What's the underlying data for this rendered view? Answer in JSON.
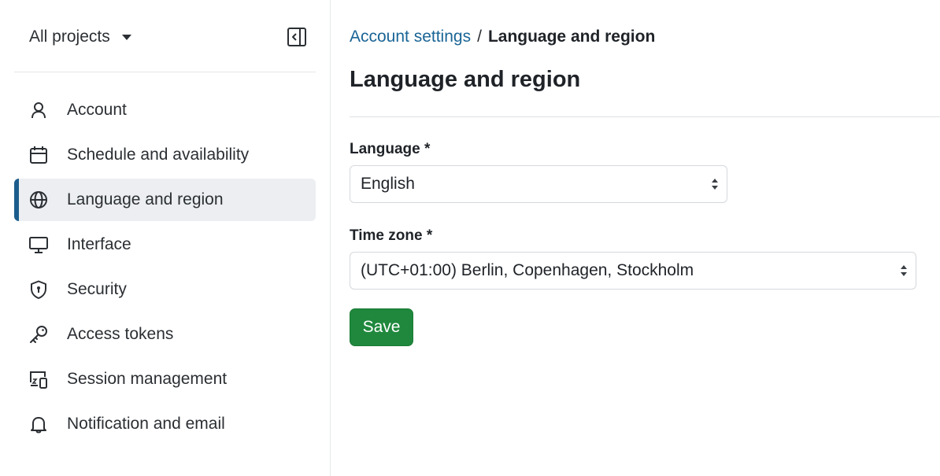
{
  "sidebar": {
    "project_selector": "All projects",
    "items": [
      {
        "label": "Account",
        "icon": "person-icon",
        "active": false
      },
      {
        "label": "Schedule and availability",
        "icon": "calendar-icon",
        "active": false
      },
      {
        "label": "Language and region",
        "icon": "globe-icon",
        "active": true
      },
      {
        "label": "Interface",
        "icon": "monitor-icon",
        "active": false
      },
      {
        "label": "Security",
        "icon": "shield-icon",
        "active": false
      },
      {
        "label": "Access tokens",
        "icon": "key-icon",
        "active": false
      },
      {
        "label": "Session management",
        "icon": "devices-icon",
        "active": false
      },
      {
        "label": "Notification and email",
        "icon": "bell-icon",
        "active": false
      }
    ]
  },
  "breadcrumb": {
    "parent": "Account settings",
    "separator": "/",
    "current": "Language and region"
  },
  "page": {
    "title": "Language and region"
  },
  "form": {
    "language_label": "Language *",
    "language_value": "English",
    "timezone_label": "Time zone *",
    "timezone_value": "(UTC+01:00) Berlin, Copenhagen, Stockholm",
    "save_label": "Save"
  },
  "colors": {
    "accent": "#1b5c8c",
    "link": "#1a6596",
    "save_button": "#1f883d",
    "active_item_bg": "#eceef1"
  }
}
